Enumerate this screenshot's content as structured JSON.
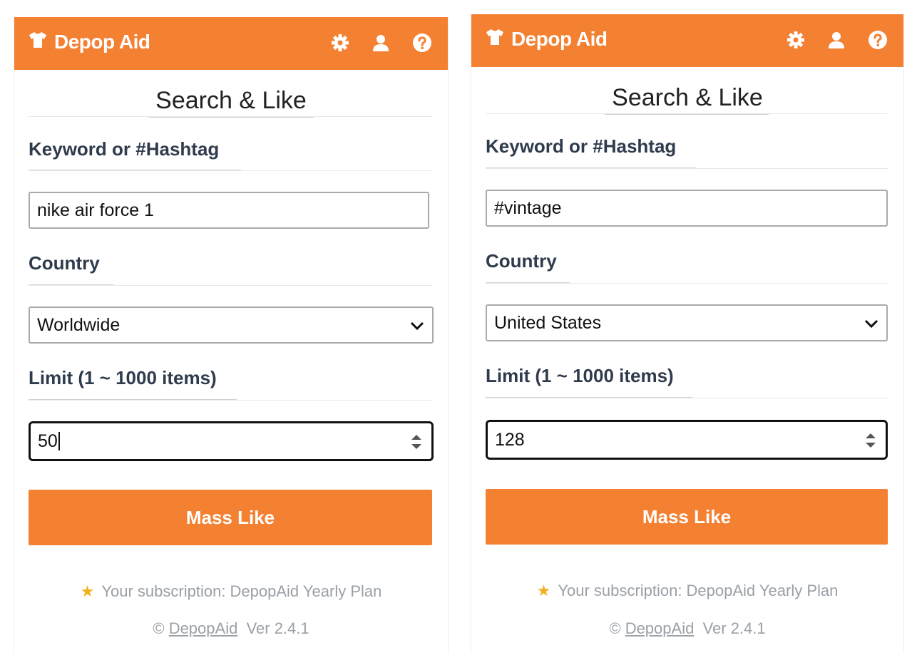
{
  "panels": [
    {
      "brand": "Depop Aid",
      "title": "Search & Like",
      "keyword_label": "Keyword or #Hashtag",
      "keyword_value": "nike air force 1",
      "country_label": "Country",
      "country_value": "Worldwide",
      "limit_label": "Limit (1 ~ 1000 items)",
      "limit_value": "50",
      "button": "Mass Like",
      "subscription": "Your subscription: DepopAid Yearly Plan",
      "copyright": "©",
      "link": "DepopAid",
      "version": "Ver 2.4.1"
    },
    {
      "brand": "Depop Aid",
      "title": "Search & Like",
      "keyword_label": "Keyword or #Hashtag",
      "keyword_value": "#vintage",
      "country_label": "Country",
      "country_value": "United States",
      "limit_label": "Limit (1 ~ 1000 items)",
      "limit_value": "128",
      "button": "Mass Like",
      "subscription": "Your subscription: DepopAid Yearly Plan",
      "copyright": "©",
      "link": "DepopAid",
      "version": "Ver 2.4.1"
    }
  ],
  "icons": {
    "brand": "tshirt-icon",
    "settings": "gear-icon",
    "account": "user-icon",
    "help": "question-circle-icon",
    "select": "chevron-down-icon",
    "number": "spinner-arrows-icon",
    "star": "star-icon"
  },
  "colors": {
    "accent": "#f48032",
    "text": "#2f3b4c",
    "muted": "#9aa0a6",
    "star": "#f2b01e"
  }
}
